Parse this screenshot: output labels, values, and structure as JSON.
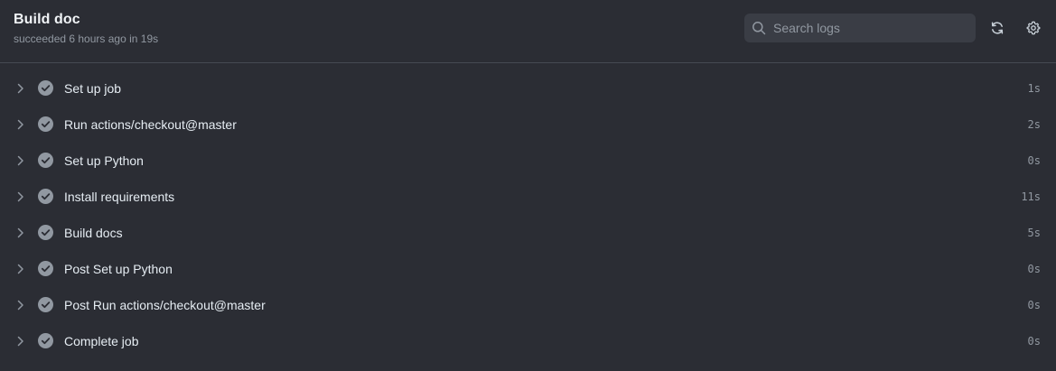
{
  "header": {
    "title": "Build doc",
    "subtitle": "succeeded 6 hours ago in 19s"
  },
  "search": {
    "placeholder": "Search logs",
    "value": ""
  },
  "toolbar": {
    "refresh_icon": "refresh-icon",
    "settings_icon": "gear-icon"
  },
  "colors": {
    "background": "#2b2d34",
    "search_background": "#3a3d45",
    "text_primary": "#e6edf3",
    "text_muted": "#9198a1",
    "success_check_bg": "#9198a1"
  },
  "steps": [
    {
      "label": "Set up job",
      "duration": "1s",
      "status": "success"
    },
    {
      "label": "Run actions/checkout@master",
      "duration": "2s",
      "status": "success"
    },
    {
      "label": "Set up Python",
      "duration": "0s",
      "status": "success"
    },
    {
      "label": "Install requirements",
      "duration": "11s",
      "status": "success"
    },
    {
      "label": "Build docs",
      "duration": "5s",
      "status": "success"
    },
    {
      "label": "Post Set up Python",
      "duration": "0s",
      "status": "success"
    },
    {
      "label": "Post Run actions/checkout@master",
      "duration": "0s",
      "status": "success"
    },
    {
      "label": "Complete job",
      "duration": "0s",
      "status": "success"
    }
  ]
}
